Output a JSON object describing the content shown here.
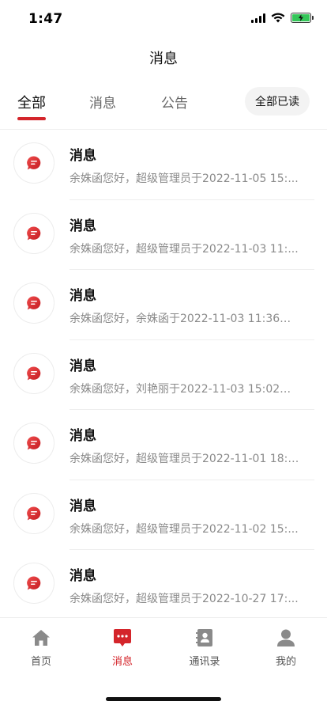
{
  "status_bar": {
    "time": "1:47"
  },
  "header": {
    "title": "消息"
  },
  "tabs": [
    {
      "label": "全部",
      "active": true
    },
    {
      "label": "消息",
      "active": false
    },
    {
      "label": "公告",
      "active": false
    }
  ],
  "mark_all_read_label": "全部已读",
  "messages": [
    {
      "title": "消息",
      "preview": "余姝函您好，超级管理员于2022-11-05 15:..."
    },
    {
      "title": "消息",
      "preview": "余姝函您好，超级管理员于2022-11-03 11:..."
    },
    {
      "title": "消息",
      "preview": "余姝函您好，余姝函于2022-11-03 11:36提..."
    },
    {
      "title": "消息",
      "preview": "余姝函您好，刘艳丽于2022-11-03 15:02提..."
    },
    {
      "title": "消息",
      "preview": "余姝函您好，超级管理员于2022-11-01 18:1..."
    },
    {
      "title": "消息",
      "preview": "余姝函您好，超级管理员于2022-11-02 15:..."
    },
    {
      "title": "消息",
      "preview": "余姝函您好，超级管理员于2022-10-27 17:..."
    }
  ],
  "bottom_nav": [
    {
      "label": "首页",
      "icon": "home-icon",
      "active": false
    },
    {
      "label": "消息",
      "icon": "message-icon",
      "active": true
    },
    {
      "label": "通讯录",
      "icon": "contacts-icon",
      "active": false
    },
    {
      "label": "我的",
      "icon": "profile-icon",
      "active": false
    }
  ],
  "colors": {
    "accent": "#d4252b",
    "muted_icon": "#8a8a8a",
    "battery": "#34c759"
  }
}
